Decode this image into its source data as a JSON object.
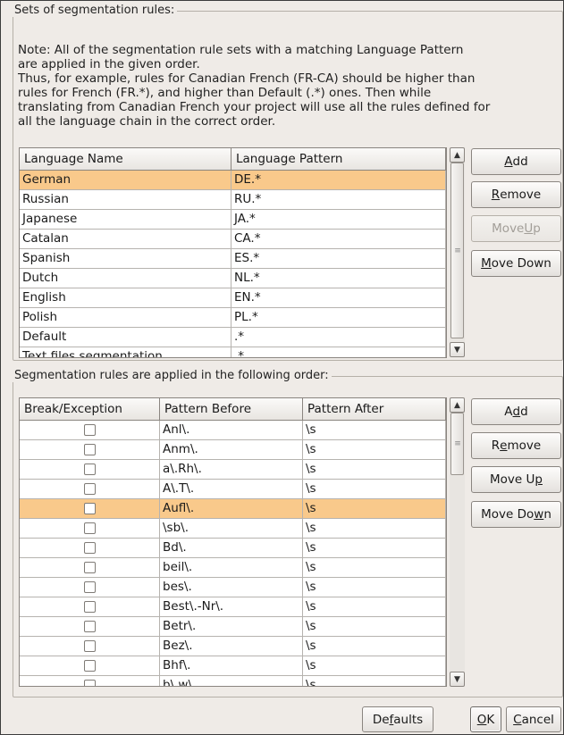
{
  "sets_group": {
    "title": "Sets of segmentation rules:",
    "note": [
      "Note: All of the segmentation rule sets with a matching Language Pattern",
      "are applied in the given order.",
      "Thus, for example, rules for Canadian French (FR-CA) should be higher than",
      "rules for French (FR.*), and higher than Default (.*) ones. Then while",
      "translating from Canadian French your project will use all the rules defined for",
      "all the language chain in the correct order."
    ],
    "columns": [
      "Language Name",
      "Language Pattern"
    ],
    "rows": [
      {
        "name": "German",
        "pattern": "DE.*",
        "selected": true
      },
      {
        "name": "Russian",
        "pattern": "RU.*"
      },
      {
        "name": "Japanese",
        "pattern": "JA.*"
      },
      {
        "name": "Catalan",
        "pattern": "CA.*"
      },
      {
        "name": "Spanish",
        "pattern": "ES.*"
      },
      {
        "name": "Dutch",
        "pattern": "NL.*"
      },
      {
        "name": "English",
        "pattern": "EN.*"
      },
      {
        "name": "Polish",
        "pattern": "PL.*"
      },
      {
        "name": "Default",
        "pattern": ".*"
      },
      {
        "name": "Text files segmentation",
        "pattern": ".*"
      }
    ],
    "buttons": {
      "add": {
        "pre": "",
        "key": "A",
        "post": "dd"
      },
      "remove": {
        "pre": "",
        "key": "R",
        "post": "emove"
      },
      "move_up": {
        "pre": "Move ",
        "key": "U",
        "post": "p"
      },
      "move_down": {
        "pre": "",
        "key": "M",
        "post": "ove Down"
      }
    }
  },
  "rules_group": {
    "title": "Segmentation rules are applied in the following order:",
    "columns": [
      "Break/Exception",
      "Pattern Before",
      "Pattern After"
    ],
    "rows": [
      {
        "before": "Anl\\.",
        "after": "\\s"
      },
      {
        "before": "Anm\\.",
        "after": "\\s"
      },
      {
        "before": "a\\.Rh\\.",
        "after": "\\s"
      },
      {
        "before": "A\\.T\\.",
        "after": "\\s"
      },
      {
        "before": "Aufl\\.",
        "after": "\\s",
        "selected": true
      },
      {
        "before": "\\sb\\.",
        "after": "\\s"
      },
      {
        "before": "Bd\\.",
        "after": "\\s"
      },
      {
        "before": "beil\\.",
        "after": "\\s"
      },
      {
        "before": "bes\\.",
        "after": "\\s"
      },
      {
        "before": "Best\\.-Nr\\.",
        "after": "\\s"
      },
      {
        "before": "Betr\\.",
        "after": "\\s"
      },
      {
        "before": "Bez\\.",
        "after": "\\s"
      },
      {
        "before": "Bhf\\.",
        "after": "\\s"
      },
      {
        "before": "b\\.w\\.",
        "after": "\\s"
      }
    ],
    "buttons": {
      "add": {
        "pre": "A",
        "key": "d",
        "post": "d"
      },
      "remove": {
        "pre": "R",
        "key": "e",
        "post": "move"
      },
      "move_up": {
        "pre": "Move U",
        "key": "p",
        "post": ""
      },
      "move_down": {
        "pre": "Move Do",
        "key": "w",
        "post": "n"
      }
    }
  },
  "footer": {
    "defaults": {
      "pre": "De",
      "key": "f",
      "post": "aults"
    },
    "ok": {
      "pre": "",
      "key": "O",
      "post": "K"
    },
    "cancel": {
      "pre": "",
      "key": "C",
      "post": "ancel"
    }
  }
}
